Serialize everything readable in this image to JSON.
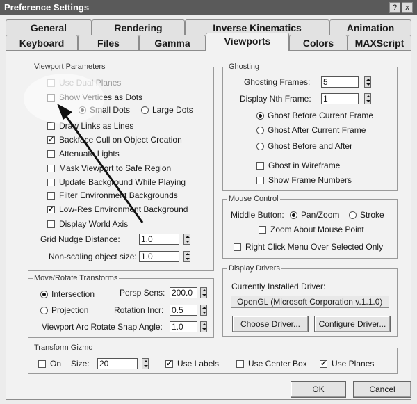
{
  "window": {
    "title": "Preference Settings",
    "help_btn": "?",
    "close_btn": "x"
  },
  "tabs_row1": [
    "General",
    "Rendering",
    "Inverse Kinematics",
    "Animation"
  ],
  "tabs_row2": [
    "Keyboard",
    "Files",
    "Gamma",
    "Viewports",
    "Colors",
    "MAXScript"
  ],
  "active_tab": "Viewports",
  "viewport_params": {
    "legend": "Viewport Parameters",
    "use_dual_planes": "Use Dual Planes",
    "show_vertices": "Show Vertices as Dots",
    "small_dots": "Small Dots",
    "large_dots": "Large Dots",
    "draw_links": "Draw Links as Lines",
    "backface_cull": "Backface Cull on Object Creation",
    "attenuate_lights": "Attenuate Lights",
    "mask_viewport": "Mask Viewport to Safe Region",
    "update_background": "Update Background While Playing",
    "filter_env": "Filter Environment Backgrounds",
    "lowres_env": "Low-Res Environment Background",
    "display_world_axis": "Display World Axis",
    "grid_nudge_label": "Grid Nudge Distance:",
    "grid_nudge_value": "1.0",
    "nonscaling_label": "Non-scaling object size:",
    "nonscaling_value": "1.0"
  },
  "move_rotate": {
    "legend": "Move/Rotate Transforms",
    "intersection": "Intersection",
    "projection": "Projection",
    "persp_sens_label": "Persp Sens:",
    "persp_sens_value": "200.0",
    "rotation_incr_label": "Rotation Incr:",
    "rotation_incr_value": "0.5",
    "arc_snap_label": "Viewport Arc Rotate Snap Angle:",
    "arc_snap_value": "1.0"
  },
  "ghosting": {
    "legend": "Ghosting",
    "frames_label": "Ghosting Frames:",
    "frames_value": "5",
    "nth_label": "Display Nth Frame:",
    "nth_value": "1",
    "before": "Ghost Before Current Frame",
    "after": "Ghost After Current Frame",
    "before_after": "Ghost Before and After",
    "wireframe": "Ghost in Wireframe",
    "frame_numbers": "Show Frame Numbers"
  },
  "mouse_control": {
    "legend": "Mouse Control",
    "middle_button": "Middle Button:",
    "pan_zoom": "Pan/Zoom",
    "stroke": "Stroke",
    "zoom_about": "Zoom About Mouse Point",
    "right_click": "Right Click Menu Over Selected Only"
  },
  "display_drivers": {
    "legend": "Display Drivers",
    "current_label": "Currently Installed Driver:",
    "current_value": "OpenGL (Microsoft Corporation v.1.1.0)",
    "choose": "Choose Driver...",
    "configure": "Configure Driver..."
  },
  "transform_gizmo": {
    "legend": "Transform Gizmo",
    "on": "On",
    "size_label": "Size:",
    "size_value": "20",
    "use_labels": "Use Labels",
    "use_center_box": "Use Center Box",
    "use_planes": "Use Planes"
  },
  "footer": {
    "ok": "OK",
    "cancel": "Cancel"
  },
  "check_mark": "✓"
}
